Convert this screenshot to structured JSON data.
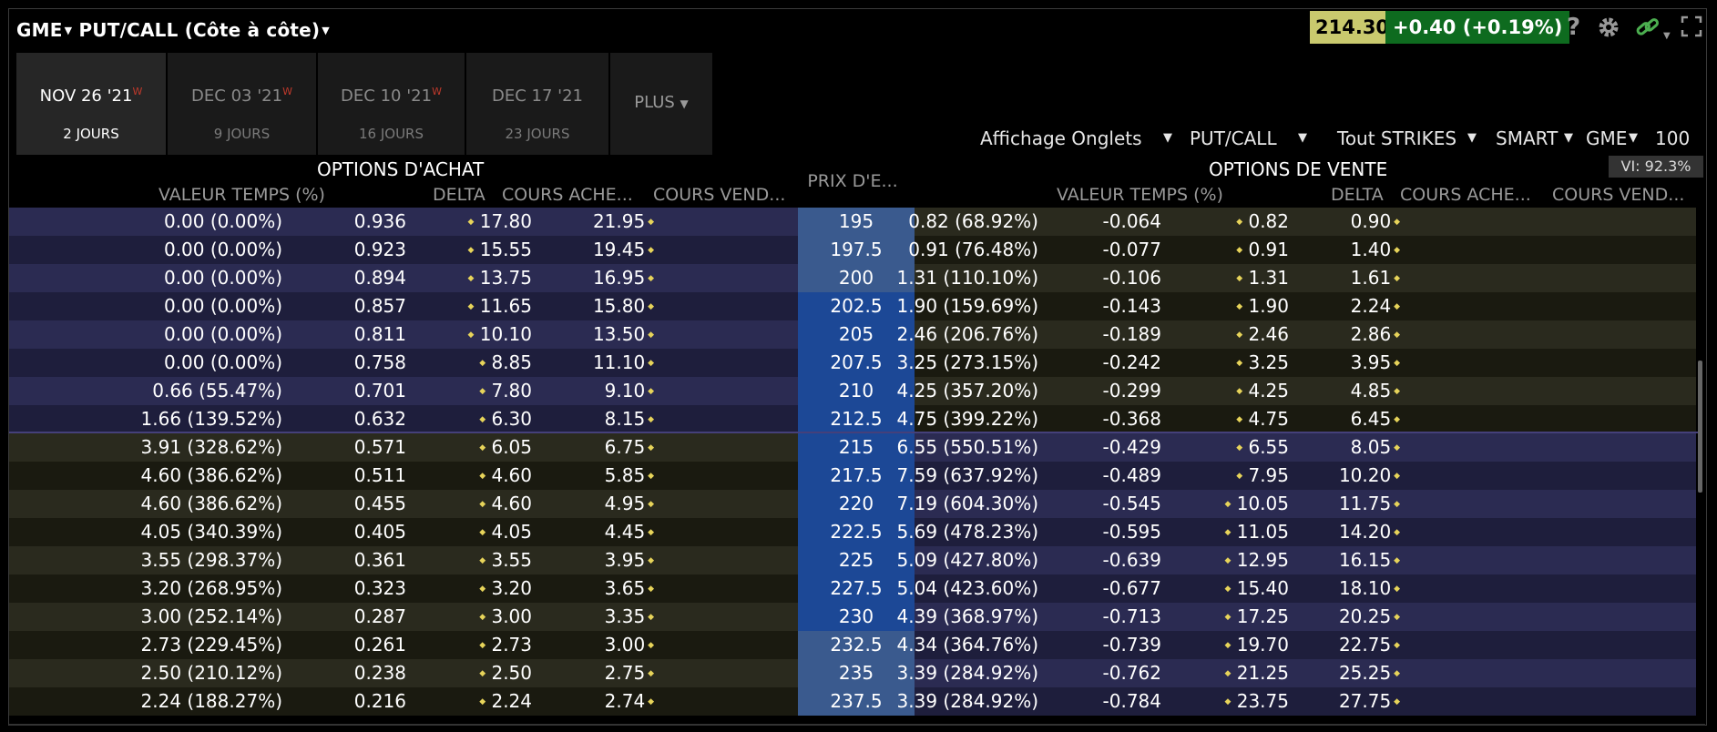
{
  "title": {
    "symbol": "GME",
    "view": "PUT/CALL (Côte à côte)"
  },
  "quote": {
    "price": "214.30",
    "change": "+0.40 (+0.19%)"
  },
  "icons": [
    "help-icon",
    "gear-icon",
    "link-icon",
    "maximize-icon"
  ],
  "tabs": [
    {
      "date": "NOV 26 '21",
      "sup": "W",
      "days": "2 JOURS"
    },
    {
      "date": "DEC 03 '21",
      "sup": "W",
      "days": "9 JOURS"
    },
    {
      "date": "DEC 10 '21",
      "sup": "W",
      "days": "16 JOURS"
    },
    {
      "date": "DEC 17 '21",
      "sup": "",
      "days": "23 JOURS"
    }
  ],
  "plus_label": "PLUS",
  "controls": {
    "affichage": "Affichage Onglets",
    "putcall": "PUT/CALL",
    "strikes": "Tout STRIKES",
    "exchange": "SMART",
    "symbol": "GME",
    "multiplier": "100"
  },
  "vi": "VI: 92.3%",
  "calls_header": "OPTIONS D'ACHAT",
  "puts_header": "OPTIONS DE VENTE",
  "columns": {
    "time_value": "VALEUR TEMPS (%)",
    "delta": "DELTA",
    "bid": "COURS ACHE...",
    "ask": "COURS VEND...",
    "strike": "PRIX D'E..."
  },
  "rows": [
    {
      "strike": "195",
      "c_tv": "0.00 (0.00%)",
      "c_delta": "0.936",
      "c_bid": "17.80",
      "c_ask": "21.95",
      "p_tv": "0.82 (68.92%)",
      "p_delta": "-0.064",
      "p_bid": "0.82",
      "p_ask": "0.90"
    },
    {
      "strike": "197.5",
      "c_tv": "0.00 (0.00%)",
      "c_delta": "0.923",
      "c_bid": "15.55",
      "c_ask": "19.45",
      "p_tv": "0.91 (76.48%)",
      "p_delta": "-0.077",
      "p_bid": "0.91",
      "p_ask": "1.40"
    },
    {
      "strike": "200",
      "c_tv": "0.00 (0.00%)",
      "c_delta": "0.894",
      "c_bid": "13.75",
      "c_ask": "16.95",
      "p_tv": "1.31 (110.10%)",
      "p_delta": "-0.106",
      "p_bid": "1.31",
      "p_ask": "1.61"
    },
    {
      "strike": "202.5",
      "c_tv": "0.00 (0.00%)",
      "c_delta": "0.857",
      "c_bid": "11.65",
      "c_ask": "15.80",
      "p_tv": "1.90 (159.69%)",
      "p_delta": "-0.143",
      "p_bid": "1.90",
      "p_ask": "2.24"
    },
    {
      "strike": "205",
      "c_tv": "0.00 (0.00%)",
      "c_delta": "0.811",
      "c_bid": "10.10",
      "c_ask": "13.50",
      "p_tv": "2.46 (206.76%)",
      "p_delta": "-0.189",
      "p_bid": "2.46",
      "p_ask": "2.86"
    },
    {
      "strike": "207.5",
      "c_tv": "0.00 (0.00%)",
      "c_delta": "0.758",
      "c_bid": "8.85",
      "c_ask": "11.10",
      "p_tv": "3.25 (273.15%)",
      "p_delta": "-0.242",
      "p_bid": "3.25",
      "p_ask": "3.95"
    },
    {
      "strike": "210",
      "c_tv": "0.66 (55.47%)",
      "c_delta": "0.701",
      "c_bid": "7.80",
      "c_ask": "9.10",
      "p_tv": "4.25 (357.20%)",
      "p_delta": "-0.299",
      "p_bid": "4.25",
      "p_ask": "4.85"
    },
    {
      "strike": "212.5",
      "c_tv": "1.66 (139.52%)",
      "c_delta": "0.632",
      "c_bid": "6.30",
      "c_ask": "8.15",
      "p_tv": "4.75 (399.22%)",
      "p_delta": "-0.368",
      "p_bid": "4.75",
      "p_ask": "6.45"
    },
    {
      "strike": "215",
      "c_tv": "3.91 (328.62%)",
      "c_delta": "0.571",
      "c_bid": "6.05",
      "c_ask": "6.75",
      "p_tv": "6.55 (550.51%)",
      "p_delta": "-0.429",
      "p_bid": "6.55",
      "p_ask": "8.05"
    },
    {
      "strike": "217.5",
      "c_tv": "4.60 (386.62%)",
      "c_delta": "0.511",
      "c_bid": "4.60",
      "c_ask": "5.85",
      "p_tv": "7.59 (637.92%)",
      "p_delta": "-0.489",
      "p_bid": "7.95",
      "p_ask": "10.20"
    },
    {
      "strike": "220",
      "c_tv": "4.60 (386.62%)",
      "c_delta": "0.455",
      "c_bid": "4.60",
      "c_ask": "4.95",
      "p_tv": "7.19 (604.30%)",
      "p_delta": "-0.545",
      "p_bid": "10.05",
      "p_ask": "11.75"
    },
    {
      "strike": "222.5",
      "c_tv": "4.05 (340.39%)",
      "c_delta": "0.405",
      "c_bid": "4.05",
      "c_ask": "4.45",
      "p_tv": "5.69 (478.23%)",
      "p_delta": "-0.595",
      "p_bid": "11.05",
      "p_ask": "14.20"
    },
    {
      "strike": "225",
      "c_tv": "3.55 (298.37%)",
      "c_delta": "0.361",
      "c_bid": "3.55",
      "c_ask": "3.95",
      "p_tv": "5.09 (427.80%)",
      "p_delta": "-0.639",
      "p_bid": "12.95",
      "p_ask": "16.15"
    },
    {
      "strike": "227.5",
      "c_tv": "3.20 (268.95%)",
      "c_delta": "0.323",
      "c_bid": "3.20",
      "c_ask": "3.65",
      "p_tv": "5.04 (423.60%)",
      "p_delta": "-0.677",
      "p_bid": "15.40",
      "p_ask": "18.10"
    },
    {
      "strike": "230",
      "c_tv": "3.00 (252.14%)",
      "c_delta": "0.287",
      "c_bid": "3.00",
      "c_ask": "3.35",
      "p_tv": "4.39 (368.97%)",
      "p_delta": "-0.713",
      "p_bid": "17.25",
      "p_ask": "20.25"
    },
    {
      "strike": "232.5",
      "c_tv": "2.73 (229.45%)",
      "c_delta": "0.261",
      "c_bid": "2.73",
      "c_ask": "3.00",
      "p_tv": "4.34 (364.76%)",
      "p_delta": "-0.739",
      "p_bid": "19.70",
      "p_ask": "22.75"
    },
    {
      "strike": "235",
      "c_tv": "2.50 (210.12%)",
      "c_delta": "0.238",
      "c_bid": "2.50",
      "c_ask": "2.75",
      "p_tv": "3.39 (284.92%)",
      "p_delta": "-0.762",
      "p_bid": "21.25",
      "p_ask": "25.25"
    },
    {
      "strike": "237.5",
      "c_tv": "2.24 (188.27%)",
      "c_delta": "0.216",
      "c_bid": "2.24",
      "c_ask": "2.74",
      "p_tv": "3.39 (284.92%)",
      "p_delta": "-0.784",
      "p_bid": "23.75",
      "p_ask": "27.75"
    }
  ]
}
